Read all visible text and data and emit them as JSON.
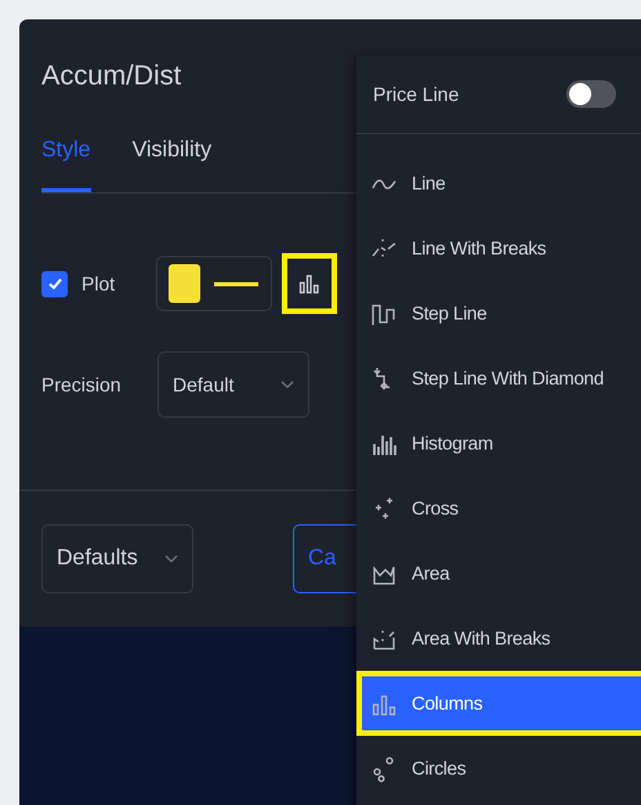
{
  "dialog": {
    "title": "Accum/Dist",
    "tabs": [
      {
        "label": "Style",
        "selected": true
      },
      {
        "label": "Visibility",
        "selected": false
      }
    ],
    "plot": {
      "label": "Plot",
      "checked": true,
      "color": "#f7e035",
      "style_button_highlighted": true
    },
    "precision": {
      "label": "Precision",
      "value": "Default"
    },
    "footer": {
      "defaults": "Defaults",
      "cancel": "Ca"
    }
  },
  "menu": {
    "price_line": {
      "label": "Price Line",
      "on": false
    },
    "items": [
      {
        "kind": "line",
        "label": "Line",
        "selected": false,
        "highlighted": false
      },
      {
        "kind": "line_breaks",
        "label": "Line With Breaks",
        "selected": false,
        "highlighted": false
      },
      {
        "kind": "step",
        "label": "Step Line",
        "selected": false,
        "highlighted": false
      },
      {
        "kind": "step_diamond",
        "label": "Step Line With Diamond",
        "selected": false,
        "highlighted": false
      },
      {
        "kind": "histogram",
        "label": "Histogram",
        "selected": false,
        "highlighted": false
      },
      {
        "kind": "cross",
        "label": "Cross",
        "selected": false,
        "highlighted": false
      },
      {
        "kind": "area",
        "label": "Area",
        "selected": false,
        "highlighted": false
      },
      {
        "kind": "area_breaks",
        "label": "Area With Breaks",
        "selected": false,
        "highlighted": false
      },
      {
        "kind": "columns",
        "label": "Columns",
        "selected": true,
        "highlighted": true
      },
      {
        "kind": "circles",
        "label": "Circles",
        "selected": false,
        "highlighted": false
      }
    ]
  }
}
